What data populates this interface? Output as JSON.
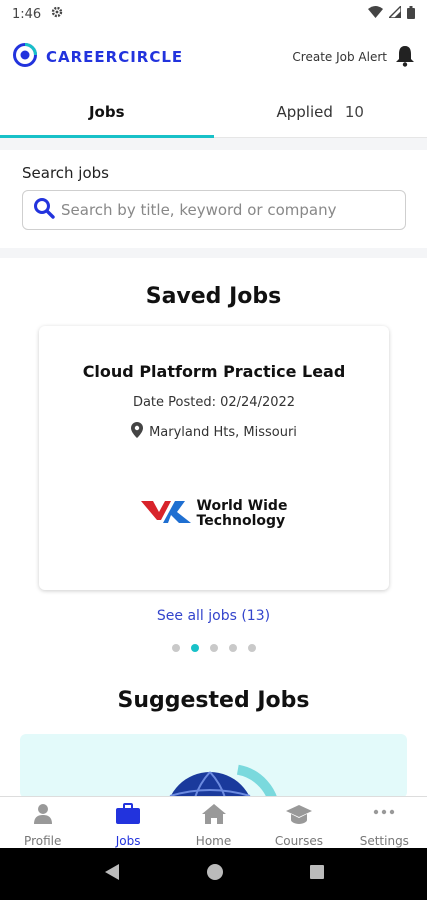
{
  "status_bar": {
    "time": "1:46"
  },
  "header": {
    "brand": "CAREERCIRCLE",
    "alert_label": "Create Job Alert"
  },
  "tabs": [
    {
      "label": "Jobs",
      "count": ""
    },
    {
      "label": "Applied",
      "count": "10"
    }
  ],
  "search": {
    "label": "Search jobs",
    "placeholder": "Search by title, keyword or company",
    "value": ""
  },
  "saved_jobs": {
    "title": "Saved Jobs",
    "card": {
      "title": "Cloud Platform Practice Lead",
      "date_posted": "Date Posted: 02/24/2022",
      "location": "Maryland Hts, Missouri",
      "company_line1": "World Wide",
      "company_line2": "Technology"
    },
    "see_all": "See all jobs (13)",
    "pager": {
      "current": 2,
      "total": 5
    }
  },
  "suggested_jobs": {
    "title": "Suggested Jobs"
  },
  "bottom_nav": [
    {
      "label": "Profile",
      "icon": "person-icon"
    },
    {
      "label": "Jobs",
      "icon": "briefcase-icon"
    },
    {
      "label": "Home",
      "icon": "home-icon"
    },
    {
      "label": "Courses",
      "icon": "graduation-cap-icon"
    },
    {
      "label": "Settings",
      "icon": "more-icon"
    }
  ],
  "colors": {
    "brand_blue": "#2233dd",
    "accent_teal": "#18c1c8",
    "link_blue": "#3344cc"
  }
}
